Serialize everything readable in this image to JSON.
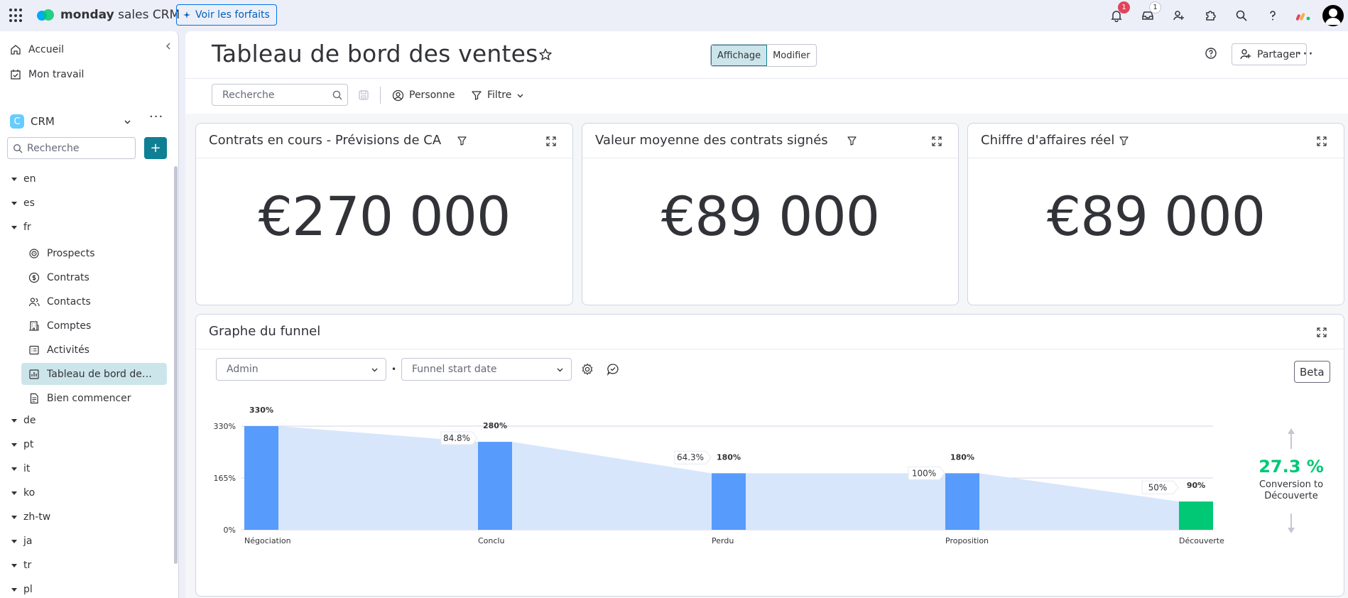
{
  "topbar": {
    "brand_bold": "monday",
    "brand_rest": " sales CRM",
    "upgrade_label": "Voir les forfaits",
    "notif_count": "1",
    "inbox_count": "1"
  },
  "sidebar": {
    "home": "Accueil",
    "my_work": "Mon travail",
    "workspace_letter": "C",
    "workspace_name": "CRM",
    "search_placeholder": "Recherche",
    "folders_top": [
      "en",
      "es",
      "fr"
    ],
    "boards": [
      {
        "label": "Prospects",
        "icon": "target-icon"
      },
      {
        "label": "Contrats",
        "icon": "dollar-icon"
      },
      {
        "label": "Contacts",
        "icon": "people-icon"
      },
      {
        "label": "Comptes",
        "icon": "building-icon"
      },
      {
        "label": "Activités",
        "icon": "activity-icon"
      },
      {
        "label": "Tableau de bord des ventes",
        "icon": "dashboard-icon"
      },
      {
        "label": "Bien commencer",
        "icon": "doc-icon"
      }
    ],
    "folders_bottom": [
      "de",
      "pt",
      "it",
      "ko",
      "zh-tw",
      "ja",
      "tr",
      "pl"
    ]
  },
  "main": {
    "title": "Tableau de bord des ventes",
    "view_label": "Affichage",
    "edit_label": "Modifier",
    "share_label": "Partager",
    "search_placeholder": "Recherche",
    "person_label": "Personne",
    "filter_label": "Filtre"
  },
  "widgets": [
    {
      "title": "Contrats en cours - Prévisions de CA",
      "value": "€270 000"
    },
    {
      "title": "Valeur moyenne des contrats signés",
      "value": "€89 000"
    },
    {
      "title": "Chiffre d'affaires réel",
      "value": "€89 000"
    }
  ],
  "funnel": {
    "title": "Graphe du funnel",
    "dropdown1": "Admin",
    "dropdown2": "Funnel start date",
    "beta": "Beta",
    "conversion_value": "27.3 %",
    "conversion_label_1": "Conversion to",
    "conversion_label_2": "Découverte"
  },
  "chart_data": {
    "type": "bar",
    "categories": [
      "Négociation",
      "Conclu",
      "Perdu",
      "Proposition",
      "Découverte"
    ],
    "values": [
      330,
      280,
      180,
      180,
      90
    ],
    "value_labels": [
      "330%",
      "280%",
      "180%",
      "180%",
      "90%"
    ],
    "step_conversions": [
      "84.8%",
      "64.3%",
      "100%",
      "50%"
    ],
    "yticks": [
      "330%",
      "165%",
      "0%"
    ],
    "ylim": [
      0,
      330
    ],
    "grid": true,
    "colors": {
      "bar": "#579bfc",
      "last_bar": "#00c875",
      "area": "#d8e6fc",
      "conversion": "#00c875"
    }
  }
}
